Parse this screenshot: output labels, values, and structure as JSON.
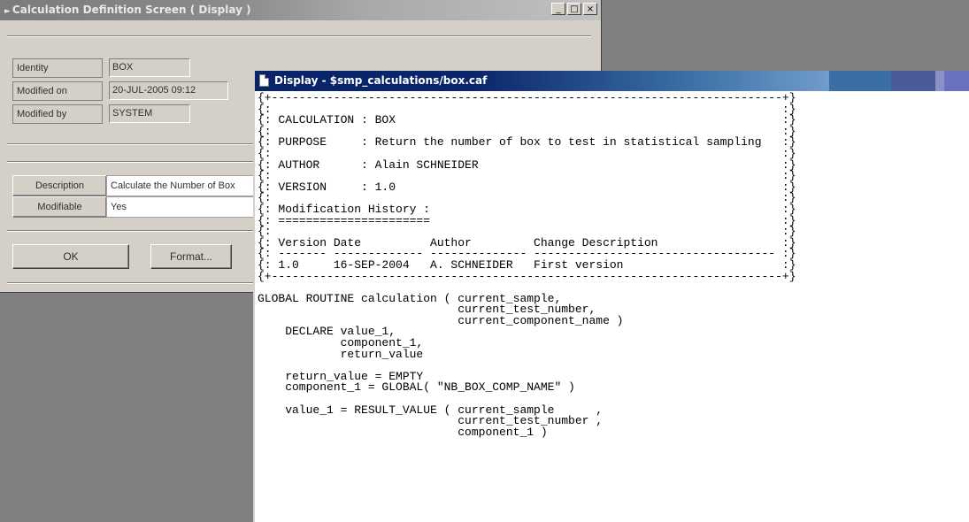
{
  "back_window": {
    "title": "Calculation Definition Screen ( Display )",
    "controls": {
      "minimize": "_",
      "maximize": "□",
      "close": "×"
    },
    "fields": [
      {
        "label": "Identity",
        "value": "BOX"
      },
      {
        "label": "Modified on",
        "value": "20-JUL-2005 09:12"
      },
      {
        "label": "Modified by",
        "value": "SYSTEM"
      }
    ],
    "properties": [
      {
        "label": "Description",
        "value": "Calculate the Number of Box"
      },
      {
        "label": "Modifiable",
        "value": "Yes"
      }
    ],
    "buttons": {
      "ok": "OK",
      "format": "Format..."
    }
  },
  "front_window": {
    "title": "Display - $smp_calculations/box.caf",
    "content_lines": [
      "{+--------------------------------------------------------------------------+}",
      "{:                                                                          :}",
      "{: CALCULATION : BOX                                                        :}",
      "{:                                                                          :}",
      "{: PURPOSE     : Return the number of box to test in statistical sampling   :}",
      "{:                                                                          :}",
      "{: AUTHOR      : Alain SCHNEIDER                                            :}",
      "{:                                                                          :}",
      "{: VERSION     : 1.0                                                        :}",
      "{:                                                                          :}",
      "{: Modification History :                                                   :}",
      "{: ======================                                                   :}",
      "{:                                                                          :}",
      "{: Version Date          Author         Change Description                  :}",
      "{: ------- ------------- -------------- ----------------------------------- :}",
      "{: 1.0     16-SEP-2004   A. SCHNEIDER   First version                       :}",
      "{+--------------------------------------------------------------------------+}",
      "",
      "GLOBAL ROUTINE calculation ( current_sample,",
      "                             current_test_number,",
      "                             current_component_name )",
      "    DECLARE value_1,",
      "            component_1,",
      "            return_value",
      "",
      "    return_value = EMPTY",
      "    component_1 = GLOBAL( \"NB_BOX_COMP_NAME\" )",
      "",
      "    value_1 = RESULT_VALUE ( current_sample      ,",
      "                             current_test_number ,",
      "                             component_1 )"
    ]
  },
  "colors": {
    "desktop": "#808080",
    "window_face": "#d4d0c8",
    "active_title": "#0a246a",
    "inactive_title": "#7b7b7b"
  }
}
